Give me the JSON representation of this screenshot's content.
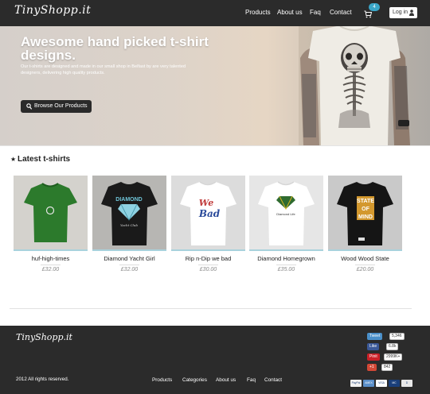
{
  "header": {
    "logo": "TinyShopp.it",
    "nav": [
      "Products",
      "About us",
      "Faq",
      "Contact"
    ],
    "cart_count": "4",
    "login_label": "Log in"
  },
  "hero": {
    "title": "Awesome hand picked t-shirt designs.",
    "description": "Our t-shirts are designed and made in our small shop in Belfast by are very talented designers, delivering high quality products.",
    "button_label": "Browse Our Products"
  },
  "latest": {
    "title": "Latest t-shirts",
    "products": [
      {
        "name": "huf-high-times",
        "price": "£32.00",
        "shirt_color": "#2c7a2c",
        "bg": "#d4d2cd"
      },
      {
        "name": "Diamond Yacht Girl",
        "price": "£32.00",
        "shirt_color": "#1a1a1a",
        "bg": "#b7b6b3"
      },
      {
        "name": "Rip n-Dip we bad",
        "price": "£30.00",
        "shirt_color": "#ffffff",
        "bg": "#dcdcdc"
      },
      {
        "name": "Diamond Homegrown",
        "price": "£35.00",
        "shirt_color": "#ffffff",
        "bg": "#e6e6e6"
      },
      {
        "name": "Wood Wood State",
        "price": "£20.00",
        "shirt_color": "#151515",
        "bg": "#c9c9c9"
      }
    ]
  },
  "footer": {
    "logo": "TinyShopp.it",
    "copyright": "2012 All rights reserved.",
    "nav": [
      "Products",
      "Categories",
      "About us",
      "Faq",
      "Contact"
    ],
    "social": [
      {
        "label": "Tweet",
        "count": "5,346",
        "color": "#4a8fc9"
      },
      {
        "label": "Like",
        "count": "6.8k",
        "color": "#3b5998"
      },
      {
        "label": "Pinit",
        "count": "2999K+",
        "color": "#cb2027"
      },
      {
        "label": "+1",
        "count": "842",
        "color": "#d34836"
      }
    ],
    "payments": [
      "PayPal",
      "AMEX",
      "VISA",
      "MC",
      "D"
    ]
  },
  "colors": {
    "header_bg": "#2b2b2b",
    "accent": "#3aa6c8",
    "image_underline": "#a8d2dc"
  }
}
